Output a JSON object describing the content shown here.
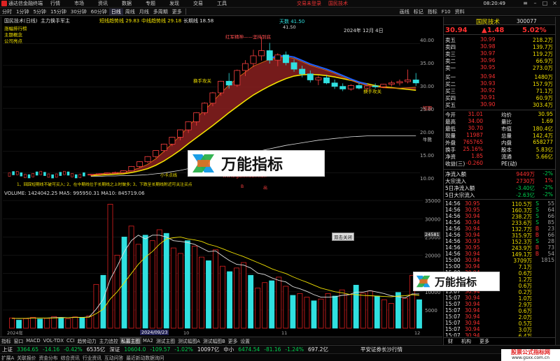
{
  "window": {
    "app_title": "通达信金融终端",
    "login_warning": "交易未登录",
    "stock_title": "国民技术",
    "clock": "08:20:49",
    "menu": [
      "行情",
      "市场",
      "资讯",
      "数据",
      "专题",
      "发现",
      "交易",
      "工具",
      "资讯",
      "窗口"
    ]
  },
  "toolbar": {
    "periods": [
      "分时",
      "1分钟",
      "5分钟",
      "15分钟",
      "30分钟",
      "60分钟",
      "日线",
      "周线",
      "月线",
      "多周期",
      "更多"
    ],
    "active_period": "日线",
    "tools": [
      "画线",
      "标记",
      "指标",
      "F10",
      "资料"
    ]
  },
  "chart": {
    "header_name": "国民技术(日线)",
    "indicator_name": "主力换手军主",
    "indicator_values": [
      "短线趋势线 29.83",
      "中线趋势线 29.18",
      "长期线 18.58"
    ],
    "left_labels": [
      "涨幅排行榜",
      "主题概念",
      "公司亮点"
    ],
    "watermark_site": "www.gsxx.com.cn",
    "badge_text": "万能指标",
    "date_label": "2024年 12月 4日",
    "high_label": "天数 41.50",
    "high_sub": "41.50",
    "annotation_top": "红军精神——坚持到底",
    "annotation_change": "换手攻关",
    "annotation_mid": "换手攻关",
    "ma_label_short": "短期",
    "ma_label_long": "牛熊",
    "bottom_ticker_text": "1、回踩短期线不破可买入; 2、在中期线位于长期线之上时做多; 3、下跌至长期线附近可关注买点",
    "bottom_small_labels": [
      "小卡点线",
      "出",
      "B"
    ],
    "y_ticks": [
      "40.00",
      "35.00",
      "30.00",
      "25.00",
      "20.00",
      "15.00",
      "10.00"
    ],
    "chart_data": {
      "type": "candlestick",
      "title": "",
      "series": [
        {
          "name": "短线趋势线",
          "values": [
            9.6,
            9.8,
            9.9,
            10.0,
            10.2,
            10.6,
            11.2,
            12.0,
            13.3,
            15.0,
            16.8,
            18.6,
            20.8,
            22.8,
            24.6,
            26.5,
            28.6,
            30.4,
            32.0,
            33.4,
            34.8,
            35.6,
            36.4,
            36.8,
            36.9,
            36.6,
            35.8,
            35.0,
            34.4,
            33.8,
            33.1,
            32.3,
            31.5,
            30.8,
            30.3,
            30.0,
            29.8,
            29.7,
            29.7,
            29.8,
            29.9
          ]
        },
        {
          "name": "中线趋势线",
          "values": [
            9.4,
            9.5,
            9.6,
            9.7,
            9.8,
            10.1,
            10.5,
            11.0,
            11.8,
            12.8,
            14.0,
            15.3,
            16.8,
            18.2,
            19.6,
            21.0,
            22.5,
            24.0,
            25.4,
            26.8,
            28.1,
            29.2,
            30.2,
            31.1,
            31.9,
            32.5,
            32.8,
            32.9,
            32.8,
            32.6,
            32.3,
            31.9,
            31.5,
            31.1,
            30.7,
            30.3,
            30.0,
            29.8,
            29.6,
            29.4,
            29.2
          ]
        },
        {
          "name": "长期线",
          "values": [
            9.2,
            9.2,
            9.3,
            9.3,
            9.4,
            9.4,
            9.5,
            9.6,
            9.8,
            10.0,
            10.3,
            10.6,
            11.0,
            11.4,
            11.8,
            12.3,
            12.8,
            13.3,
            13.8,
            14.3,
            14.8,
            15.2,
            15.6,
            16.0,
            16.4,
            16.7,
            17.0,
            17.3,
            17.6,
            17.8,
            18.0,
            18.2,
            18.4,
            18.5,
            18.6,
            18.6,
            18.6,
            18.6,
            18.6,
            18.6,
            18.6
          ]
        }
      ],
      "candles": [
        [
          9.5,
          9.8,
          9.3,
          9.7
        ],
        [
          9.7,
          9.9,
          9.5,
          9.8
        ],
        [
          9.8,
          10.1,
          9.6,
          10.0
        ],
        [
          10.0,
          10.3,
          9.8,
          10.1
        ],
        [
          10.1,
          10.6,
          10.0,
          10.5
        ],
        [
          10.5,
          11.6,
          10.4,
          11.5
        ],
        [
          11.5,
          12.7,
          11.2,
          12.6
        ],
        [
          12.6,
          13.9,
          12.3,
          13.8
        ],
        [
          13.8,
          15.2,
          13.5,
          15.2
        ],
        [
          15.2,
          16.8,
          14.8,
          16.7
        ],
        [
          16.7,
          18.4,
          16.2,
          18.3
        ],
        [
          18.3,
          20.1,
          17.6,
          20.0
        ],
        [
          20.0,
          22.0,
          19.3,
          21.9
        ],
        [
          21.9,
          24.1,
          21.0,
          24.0
        ],
        [
          24.0,
          26.4,
          23.4,
          26.2
        ],
        [
          26.2,
          28.8,
          25.5,
          28.6
        ],
        [
          28.6,
          31.4,
          27.9,
          31.3
        ],
        [
          31.3,
          33.2,
          29.6,
          30.4
        ],
        [
          30.4,
          34.0,
          30.0,
          33.8
        ],
        [
          33.8,
          36.2,
          32.5,
          35.4
        ],
        [
          35.4,
          38.6,
          34.6,
          37.2
        ],
        [
          37.2,
          41.5,
          36.1,
          38.4
        ],
        [
          38.4,
          40.2,
          35.4,
          36.2
        ],
        [
          36.2,
          37.8,
          34.8,
          37.4
        ],
        [
          37.4,
          38.2,
          35.0,
          35.6
        ],
        [
          35.6,
          36.4,
          33.5,
          34.1
        ],
        [
          34.1,
          34.9,
          32.2,
          33.0
        ],
        [
          33.0,
          33.8,
          31.0,
          31.6
        ],
        [
          31.6,
          32.6,
          30.4,
          32.1
        ],
        [
          32.1,
          32.8,
          30.6,
          30.9
        ],
        [
          30.9,
          31.7,
          29.5,
          30.1
        ],
        [
          30.1,
          30.8,
          29.0,
          29.5
        ],
        [
          29.5,
          30.6,
          29.1,
          30.3
        ],
        [
          30.3,
          30.9,
          29.4,
          29.7
        ],
        [
          29.7,
          30.4,
          28.9,
          30.2
        ],
        [
          30.2,
          30.8,
          29.6,
          30.0
        ],
        [
          30.0,
          30.7,
          29.7,
          30.6
        ],
        [
          30.6,
          31.4,
          30.1,
          30.9
        ],
        [
          30.9,
          31.7,
          30.3,
          31.2
        ],
        [
          31.2,
          34.0,
          30.8,
          31.6
        ],
        [
          31.6,
          33.2,
          30.2,
          30.9
        ]
      ],
      "ylim": [
        8,
        44
      ],
      "x_labels": [
        "2024年",
        "10",
        "11",
        "12"
      ]
    }
  },
  "volume": {
    "header": "VOLUME: 1424042.25  MA5: 995950.31  MA10: 845719.06",
    "y_ticks": [
      "35000",
      "30000",
      "25000",
      "20000",
      "15000",
      "10000",
      "5000"
    ],
    "x_date_highlight": "2024/09/23",
    "tooltip_price": "24581",
    "mini_popup": "双击关闭",
    "chart_data": {
      "type": "bar",
      "title": "",
      "values": [
        2800,
        2200,
        2600,
        3000,
        2500,
        2700,
        3200,
        2900,
        2600,
        3100,
        2800,
        3400,
        12000,
        14500,
        34000,
        20000,
        25000,
        28000,
        23000,
        25500,
        24000,
        27000,
        26000,
        22000,
        20500,
        24000,
        22500,
        19500,
        18500,
        21500,
        17000,
        15500,
        16500,
        18000,
        14500,
        11000,
        12500,
        13000,
        14000,
        11500,
        9000,
        9500,
        8500,
        7500,
        8000,
        9500,
        8800,
        10500,
        9200,
        11800,
        9600,
        10200,
        8800,
        7800,
        6800,
        9800,
        8200,
        14500,
        7800
      ],
      "colors_up": "#e02020",
      "colors_down": "#30e0e0",
      "ylim": [
        0,
        36000
      ],
      "ma5": [
        2700,
        2650,
        2700,
        2800,
        2750,
        2800,
        2900,
        2950,
        2900,
        3000,
        2950,
        3100,
        5200,
        7900,
        13400,
        17000,
        21000,
        24000,
        25500,
        24500,
        25500,
        25500,
        25000,
        24000,
        23800,
        23500,
        23000,
        22000,
        21000,
        21200,
        19800,
        18500,
        17500,
        17300,
        16500,
        15100,
        14700,
        13800,
        13100,
        12700,
        11400,
        10800,
        10100,
        9200,
        8500,
        8500,
        8600,
        9000,
        9200,
        9900,
        9900,
        10300,
        9900,
        9500,
        8900,
        8600,
        8300,
        9400,
        9400
      ],
      "ma10": [
        2700,
        2700,
        2700,
        2750,
        2750,
        2750,
        2800,
        2850,
        2900,
        2950,
        2950,
        3000,
        4000,
        5200,
        8000,
        10000,
        12500,
        15000,
        17500,
        19500,
        21000,
        23000,
        24500,
        24800,
        25000,
        24500,
        24200,
        23800,
        23000,
        22500,
        21800,
        21000,
        20300,
        19600,
        18800,
        18000,
        17200,
        16300,
        15600,
        15000,
        14100,
        13300,
        12600,
        11800,
        11000,
        10500,
        10000,
        9700,
        9300,
        9200,
        9000,
        8900,
        8800,
        8700,
        8600,
        8800,
        8900,
        9200,
        9000
      ]
    }
  },
  "right_panel": {
    "name": "国民技术",
    "code": "300077",
    "price": "30.94",
    "change": "▲1.48",
    "change_pct": "5.02%",
    "asks": [
      {
        "label": "卖五",
        "price": "30.99",
        "vol": "218.2万"
      },
      {
        "label": "卖四",
        "price": "30.98",
        "vol": "139.7万"
      },
      {
        "label": "卖三",
        "price": "30.97",
        "vol": "119.2万"
      },
      {
        "label": "卖二",
        "price": "30.96",
        "vol": "66.9万"
      },
      {
        "label": "卖一",
        "price": "30.95",
        "vol": "273.0万"
      }
    ],
    "bids": [
      {
        "label": "买一",
        "price": "30.94",
        "vol": "1480万"
      },
      {
        "label": "买二",
        "price": "30.93",
        "vol": "157.9万"
      },
      {
        "label": "买三",
        "price": "30.92",
        "vol": "71.1万"
      },
      {
        "label": "买四",
        "price": "30.91",
        "vol": "60.9万"
      },
      {
        "label": "买五",
        "price": "30.90",
        "vol": "303.4万"
      }
    ],
    "stats": [
      [
        "今开",
        "31.01",
        "均价",
        "30.95"
      ],
      [
        "最高",
        "34.00",
        "量比",
        "1.69"
      ],
      [
        "最低",
        "30.70",
        "市值",
        "180.4亿"
      ],
      [
        "现量",
        "11987",
        "总量",
        "142.4万"
      ],
      [
        "外盘",
        "765765",
        "内盘",
        "658277"
      ],
      [
        "换手",
        "25.16%",
        "股本",
        "5.83亿"
      ],
      [
        "净资",
        "1.85",
        "流通",
        "5.66亿"
      ],
      [
        "收益(三)",
        "-0.260",
        "PE(动)",
        ""
      ]
    ],
    "flows": [
      [
        "净流入额",
        "9449万",
        "-2%"
      ],
      [
        "大宗流入",
        "2730万",
        "1%"
      ],
      [
        "5日净流入额",
        "-3.40亿",
        "-2%"
      ],
      [
        "5日大宗流入",
        "-2.63亿",
        "-2%"
      ]
    ],
    "ticks": [
      [
        "14:56",
        "30.95",
        "110.5万",
        "S",
        "55"
      ],
      [
        "14:56",
        "30.95",
        "160.3万",
        "S",
        "64"
      ],
      [
        "14:56",
        "30.94",
        "238.2万",
        "S",
        "66"
      ],
      [
        "14:56",
        "30.94",
        "233.6万",
        "S",
        "85"
      ],
      [
        "14:56",
        "30.94",
        "132.7万",
        "B",
        "23"
      ],
      [
        "14:56",
        "30.94",
        "315.9万",
        "B",
        "66"
      ],
      [
        "14:56",
        "30.93",
        "152.3万",
        "S",
        "28"
      ],
      [
        "14:56",
        "30.95",
        "243.9万",
        "B",
        "73"
      ],
      [
        "14:56",
        "30.94",
        "149.1万",
        "B",
        "54"
      ],
      [
        "15:00",
        "30.94",
        "3709万",
        "",
        "1815"
      ],
      [
        "15:00",
        "30.94",
        "7.1万",
        "",
        ""
      ],
      [
        "15:00",
        "30.94",
        "0.6万",
        "",
        ""
      ],
      [
        "15:07",
        "30.94",
        "1.2万",
        "",
        ""
      ],
      [
        "15:07",
        "30.94",
        "0.6万",
        "",
        ""
      ],
      [
        "15:07",
        "30.94",
        "0.2万",
        "",
        ""
      ],
      [
        "15:07",
        "30.94",
        "1.0万",
        "",
        ""
      ],
      [
        "15:07",
        "30.94",
        "2.9万",
        "",
        ""
      ],
      [
        "15:07",
        "30.94",
        "0.6万",
        "",
        ""
      ],
      [
        "15:07",
        "30.94",
        "2.0万",
        "",
        ""
      ],
      [
        "15:07",
        "30.94",
        "0.5万",
        "",
        ""
      ],
      [
        "15:07",
        "30.94",
        "3.0万",
        "",
        ""
      ],
      [
        "15:07",
        "30.94",
        "6.4万",
        "",
        ""
      ]
    ],
    "bottom_tabs": [
      "财",
      "机构",
      "更多"
    ]
  },
  "bottom_tabs": [
    "指标",
    "窗口",
    "MACD",
    "VOL-TDX",
    "CCI",
    "趋势动力",
    "主力追控",
    "私募主图",
    "MA2",
    "测试主图",
    "测试幅图A",
    "测试幅图B",
    "更多",
    "设置"
  ],
  "status": {
    "items": [
      {
        "label": "上证",
        "value": "3364.65",
        "chg": "-14.16",
        "pct": "-0.42%",
        "amt": "6535亿"
      },
      {
        "label": "深证",
        "value": "10604.0",
        "chg": "-109.57",
        "pct": "-1.02%",
        "amt": "10097亿"
      },
      {
        "label": "中小",
        "value": "6474.54",
        "chg": "-81.16",
        "pct": "-1.24%",
        "amt": "697.2亿"
      }
    ],
    "broker": "平安证券长沙行情"
  },
  "infobar": [
    "扩展A",
    "关联报价",
    "资金分布",
    "综合资讯",
    "行业资讯",
    "互动问答",
    "最近新动数据询问"
  ],
  "site_watermark": "股票公式指标网",
  "site_url": "www.gsxx.com.cn",
  "colors": {
    "up": "#ff3030",
    "down": "#00d050",
    "accent": "#30e0e0",
    "bg": "#000000"
  }
}
